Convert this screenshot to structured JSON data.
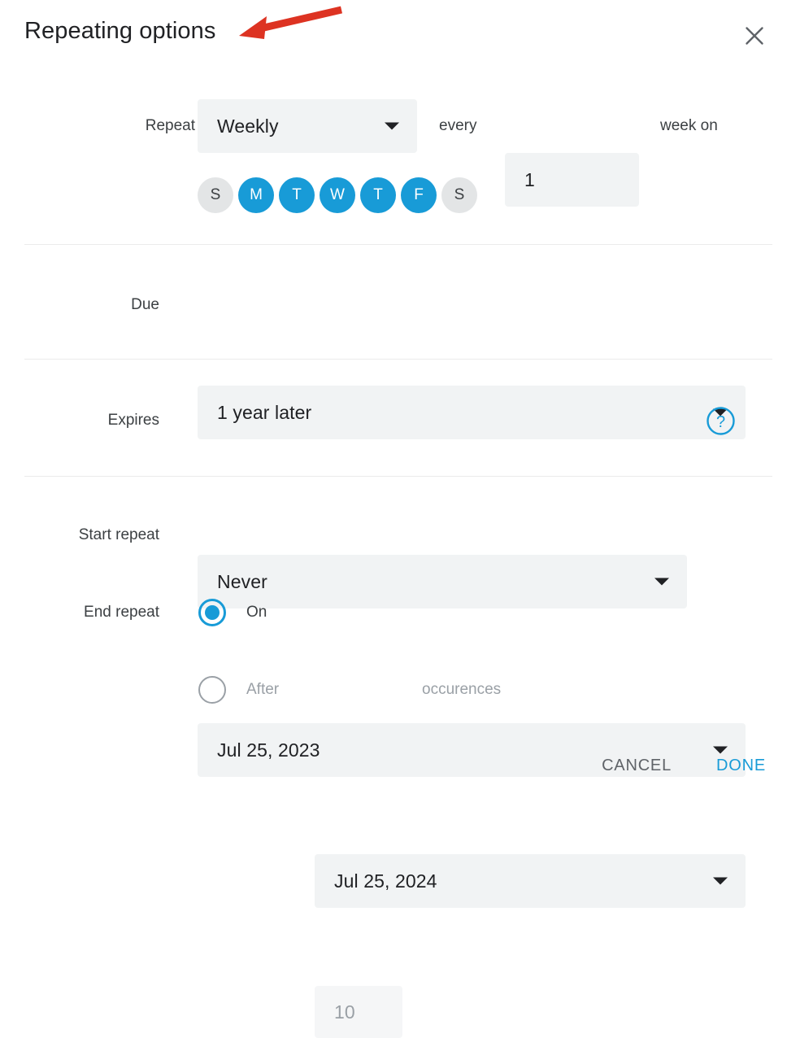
{
  "dialog": {
    "title": "Repeating options",
    "close_icon": "close-icon"
  },
  "repeat": {
    "label": "Repeat",
    "frequency_value": "Weekly",
    "every_label": "every",
    "interval_value": "1",
    "unit_label": "week on",
    "days": [
      {
        "letter": "S",
        "name": "sunday",
        "selected": false
      },
      {
        "letter": "M",
        "name": "monday",
        "selected": true
      },
      {
        "letter": "T",
        "name": "tuesday",
        "selected": true
      },
      {
        "letter": "W",
        "name": "wednesday",
        "selected": true
      },
      {
        "letter": "T",
        "name": "thursday",
        "selected": true
      },
      {
        "letter": "F",
        "name": "friday",
        "selected": true
      },
      {
        "letter": "S",
        "name": "saturday",
        "selected": false
      }
    ]
  },
  "due": {
    "label": "Due",
    "value": "1 year later"
  },
  "expires": {
    "label": "Expires",
    "value": "Never",
    "help_icon": "help-circle-icon"
  },
  "start_repeat": {
    "label": "Start repeat",
    "value": "Jul 25, 2023"
  },
  "end_repeat": {
    "label": "End repeat",
    "on_option_label": "On",
    "on_date_value": "Jul 25, 2024",
    "on_selected": true,
    "after_option_label": "After",
    "after_count_value": "10",
    "after_unit_label": "occurences",
    "after_selected": false
  },
  "footer": {
    "cancel_label": "CANCEL",
    "done_label": "DONE"
  },
  "colors": {
    "accent_blue": "#189bd7",
    "field_bg": "#f1f3f4",
    "muted_text": "#9aa0a6",
    "annotation_red": "#dd3322"
  }
}
